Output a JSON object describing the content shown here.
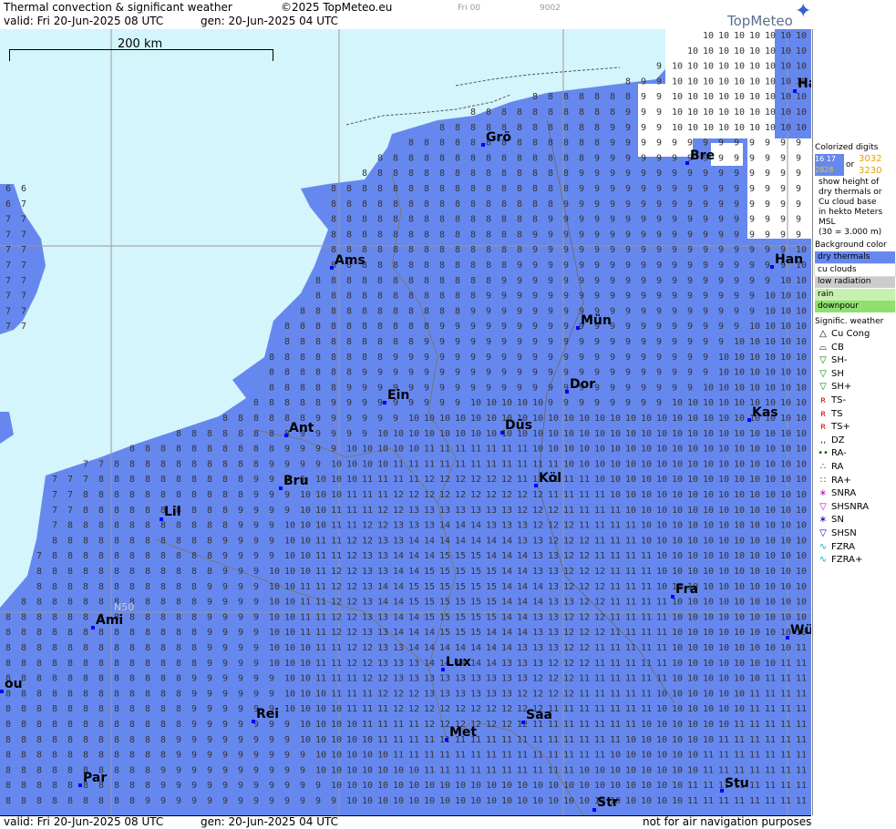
{
  "header": {
    "title": "Thermal convection & significant weather",
    "copyright": "©2025 TopMeteo.eu",
    "valid_line": "valid:  Fri  20-Jun-2025  08 UTC",
    "gen_line": "gen:  20-Jun-2025  04 UTC",
    "run_small": "Fri 00",
    "code_small": "9002",
    "logo_text": "TopMeteo"
  },
  "footer": {
    "valid_line": "valid:  Fri  20-Jun-2025  08 UTC",
    "gen_line": "gen:  20-Jun-2025  04 UTC",
    "disclaimer": "not for air navigation purposes"
  },
  "scale_label": "200 km",
  "graticule_label": "N50",
  "colors": {
    "sea": "#d4f5fb",
    "dry_thermals": "#6688ee",
    "cu_clouds": "#ffffff",
    "low_radiation": "#cccccc",
    "rain": "#c8f0b0",
    "downpour": "#90e070"
  },
  "cities": [
    {
      "name": "Grö",
      "label": "Grö"
    },
    {
      "name": "Bre",
      "label": "Bre"
    },
    {
      "name": "Ha",
      "label": "Ha"
    },
    {
      "name": "Ams",
      "label": "Ams"
    },
    {
      "name": "Han",
      "label": "Han"
    },
    {
      "name": "Mün",
      "label": "Mün"
    },
    {
      "name": "Ein",
      "label": "Ein"
    },
    {
      "name": "Dor",
      "label": "Dor"
    },
    {
      "name": "Ant",
      "label": "Ant"
    },
    {
      "name": "Düs",
      "label": "Düs"
    },
    {
      "name": "Kas",
      "label": "Kas"
    },
    {
      "name": "Bru",
      "label": "Bru"
    },
    {
      "name": "Köl",
      "label": "Köl"
    },
    {
      "name": "Lil",
      "label": "Lil"
    },
    {
      "name": "Fra",
      "label": "Fra"
    },
    {
      "name": "Ami",
      "label": "Ami"
    },
    {
      "name": "Wür",
      "label": "Wür"
    },
    {
      "name": "Lux",
      "label": "Lux"
    },
    {
      "name": "ou",
      "label": "ou"
    },
    {
      "name": "Rei",
      "label": "Rei"
    },
    {
      "name": "Saa",
      "label": "Saa"
    },
    {
      "name": "Met",
      "label": "Met"
    },
    {
      "name": "Par",
      "label": "Par"
    },
    {
      "name": "Stu",
      "label": "Stu"
    },
    {
      "name": "Str",
      "label": "Str"
    }
  ],
  "legend": {
    "colorized_title": "Colorized digits",
    "ex1": "16 17",
    "ex2": "2828",
    "ex_or": "or",
    "ex3": "3032",
    "ex4": "3230",
    "desc": [
      "show height of",
      "dry thermals or",
      "Cu cloud base",
      "in hekto Meters",
      "MSL",
      "(30 = 3.000 m)"
    ],
    "bg_title": "Background color",
    "bg_items": [
      {
        "label": "dry thermals",
        "color": "#6688ee"
      },
      {
        "label": "cu clouds",
        "color": "#ffffff"
      },
      {
        "label": "low radiation",
        "color": "#cccccc"
      },
      {
        "label": "rain",
        "color": "#c8f0b0"
      },
      {
        "label": "downpour",
        "color": "#90e070"
      }
    ],
    "wx_title": "Signific. weather",
    "wx_items": [
      {
        "label": "Cu Cong",
        "icon": "cu-cong-icon",
        "glyph": "△",
        "color": "#000"
      },
      {
        "label": "CB",
        "icon": "cb-icon",
        "glyph": "⌓",
        "color": "#000"
      },
      {
        "label": "SH-",
        "icon": "shower-light-icon",
        "glyph": "▽",
        "color": "#008800"
      },
      {
        "label": "SH",
        "icon": "shower-icon",
        "glyph": "▽",
        "color": "#008800"
      },
      {
        "label": "SH+",
        "icon": "shower-heavy-icon",
        "glyph": "▽",
        "color": "#008800"
      },
      {
        "label": "TS-",
        "icon": "thunderstorm-light-icon",
        "glyph": "ʀ",
        "color": "#dd0000"
      },
      {
        "label": "TS",
        "icon": "thunderstorm-icon",
        "glyph": "ʀ",
        "color": "#dd0000"
      },
      {
        "label": "TS+",
        "icon": "thunderstorm-heavy-icon",
        "glyph": "ʀ",
        "color": "#dd0000"
      },
      {
        "label": "DZ",
        "icon": "drizzle-icon",
        "glyph": "‚‚",
        "color": "#006600"
      },
      {
        "label": "RA-",
        "icon": "rain-light-icon",
        "glyph": "••",
        "color": "#006600"
      },
      {
        "label": "RA",
        "icon": "rain-icon",
        "glyph": "∴",
        "color": "#006600"
      },
      {
        "label": "RA+",
        "icon": "rain-heavy-icon",
        "glyph": "∷",
        "color": "#006600"
      },
      {
        "label": "SNRA",
        "icon": "snow-rain-icon",
        "glyph": "∗",
        "color": "#cc00cc"
      },
      {
        "label": "SHSNRA",
        "icon": "snow-rain-shower-icon",
        "glyph": "▽",
        "color": "#cc00cc"
      },
      {
        "label": "SN",
        "icon": "snow-icon",
        "glyph": "∗",
        "color": "#0000cc"
      },
      {
        "label": "SHSN",
        "icon": "snow-shower-icon",
        "glyph": "▽",
        "color": "#0000cc"
      },
      {
        "label": "FZRA",
        "icon": "freezing-rain-icon",
        "glyph": "∿",
        "color": "#00aacc"
      },
      {
        "label": "FZRA+",
        "icon": "freezing-rain-heavy-icon",
        "glyph": "∿",
        "color": "#00aacc"
      }
    ]
  }
}
